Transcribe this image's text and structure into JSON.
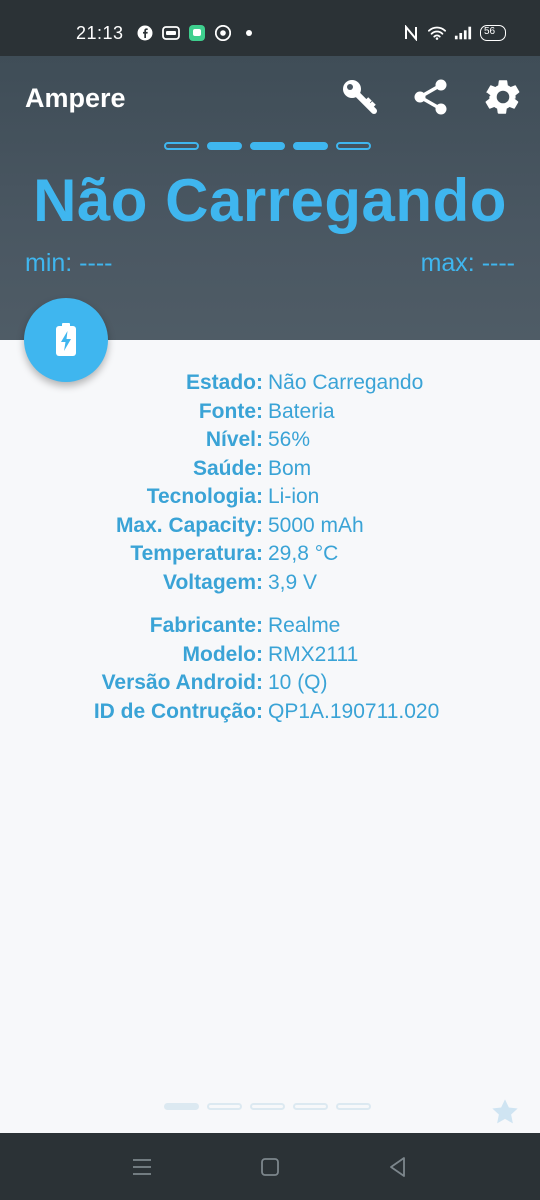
{
  "status_bar": {
    "time": "21:13",
    "left_icons": [
      "facebook-icon",
      "card-icon",
      "chat-app-icon",
      "chrome-icon",
      "dot-icon"
    ],
    "right_icons": [
      "nfc-icon",
      "wifi-icon",
      "signal-icon"
    ],
    "battery_level": "56"
  },
  "header": {
    "app_title": "Ampere",
    "actions": [
      "key-icon",
      "share-icon",
      "settings-icon"
    ],
    "state_text": "Não Carregando",
    "min_text": "min: ----",
    "max_text": "max: ----",
    "page_indicator": {
      "count": 5,
      "active": [
        2,
        3,
        4
      ]
    }
  },
  "info": {
    "battery": [
      {
        "label": "Estado:",
        "value": "Não Carregando"
      },
      {
        "label": "Fonte:",
        "value": "Bateria"
      },
      {
        "label": "Nível:",
        "value": "56%"
      },
      {
        "label": "Saúde:",
        "value": "Bom"
      },
      {
        "label": "Tecnologia:",
        "value": "Li-ion"
      },
      {
        "label": "Max. Capacity:",
        "value": "5000 mAh"
      },
      {
        "label": "Temperatura:",
        "value": "29,8 °C"
      },
      {
        "label": "Voltagem:",
        "value": "3,9 V"
      }
    ],
    "device": [
      {
        "label": "Fabricante:",
        "value": "Realme"
      },
      {
        "label": "Modelo:",
        "value": "RMX2111"
      },
      {
        "label": "Versão Android:",
        "value": "10 (Q)"
      },
      {
        "label": "ID de Contrução:",
        "value": "QP1A.190711.020"
      }
    ]
  },
  "bottom_page_indicator": {
    "count": 5,
    "active": [
      1
    ]
  },
  "colors": {
    "accent": "#3fb6ef",
    "header_bg": "#4a5762",
    "system_bar": "#2b3236",
    "content_bg": "#f7f8fa"
  }
}
